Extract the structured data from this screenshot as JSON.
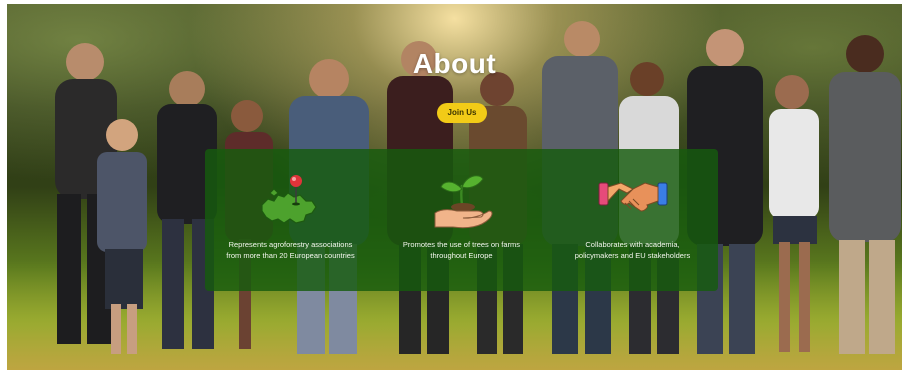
{
  "hero": {
    "title": "About",
    "join_label": "Join Us"
  },
  "features": [
    {
      "icon": "europe-map-pin-icon",
      "line1": "Represents agroforestry associations",
      "line2": "from more than 20 European countries"
    },
    {
      "icon": "hand-sprout-icon",
      "line1": "Promotes the use of trees on farms",
      "line2": "throughout Europe"
    },
    {
      "icon": "handshake-icon",
      "line1": "Collaborates with academia,",
      "line2": "policymakers and EU stakeholders"
    }
  ],
  "colors": {
    "accent_yellow": "#f2cb17",
    "panel_green": "#165c0e",
    "icon_green": "#3f9a25",
    "pin_red": "#e0333a"
  }
}
